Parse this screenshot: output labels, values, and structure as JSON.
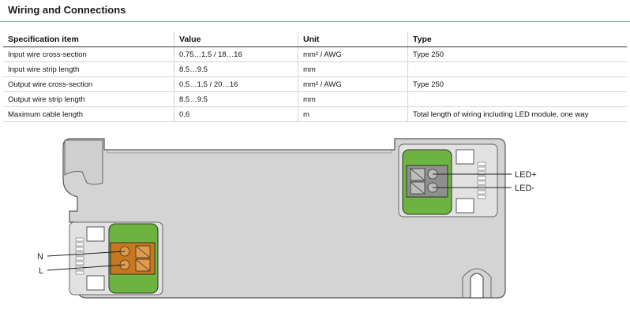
{
  "title": "Wiring and Connections",
  "table": {
    "headers": [
      "Specification item",
      "Value",
      "Unit",
      "Type"
    ],
    "rows": [
      [
        "Input wire cross-section",
        "0.75…1.5 / 18…16",
        "mm² / AWG",
        "Type 250"
      ],
      [
        "Input wire strip length",
        "8.5…9.5",
        "mm",
        ""
      ],
      [
        "Output wire cross-section",
        "0.5…1.5 / 20…16",
        "mm² / AWG",
        "Type 250"
      ],
      [
        "Output wire strip length",
        "8.5…9.5",
        "mm",
        ""
      ],
      [
        "Maximum cable length",
        "0.6",
        "m",
        "Total length of wiring including LED module, one way"
      ]
    ]
  },
  "diagram": {
    "labels": {
      "led_plus": "LED+",
      "led_minus": "LED-",
      "n": "N",
      "l": "L"
    },
    "colors": {
      "housing": "#d4d4d4",
      "housing_outline": "#555555",
      "terminal_green": "#6cb33f",
      "terminal_orange": "#c8771e",
      "block_gray": "#8f8f8f"
    }
  }
}
